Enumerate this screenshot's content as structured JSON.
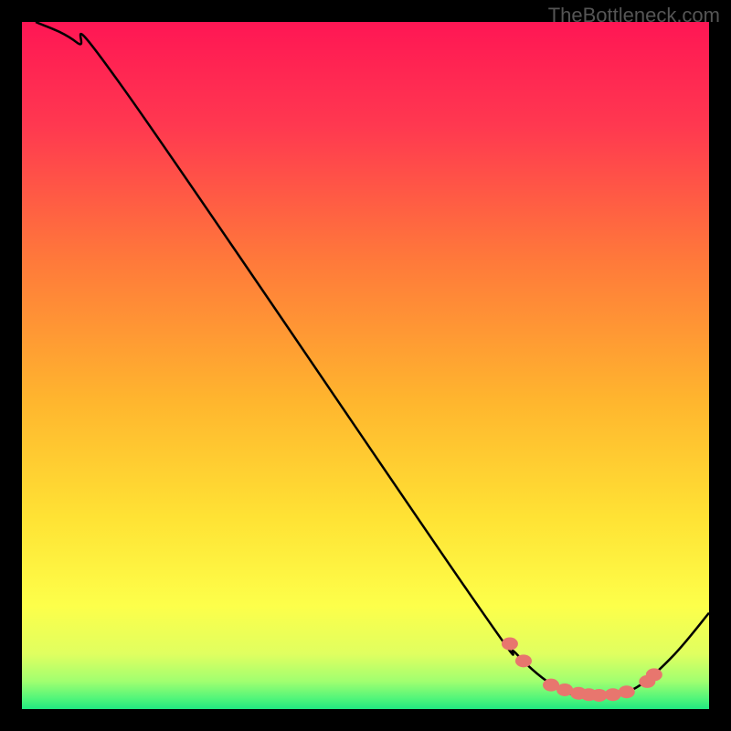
{
  "watermark": "TheBottleneck.com",
  "chart_data": {
    "type": "line",
    "title": "",
    "xlabel": "",
    "ylabel": "",
    "xlim": [
      0,
      100
    ],
    "ylim": [
      0,
      100
    ],
    "curve": {
      "description": "Valley curve descending from top-left, minimum near x=78-88, rising on right",
      "points": [
        {
          "x": 2,
          "y": 100
        },
        {
          "x": 8,
          "y": 97
        },
        {
          "x": 15,
          "y": 90
        },
        {
          "x": 65,
          "y": 17
        },
        {
          "x": 72,
          "y": 8
        },
        {
          "x": 78,
          "y": 3
        },
        {
          "x": 82,
          "y": 2
        },
        {
          "x": 86,
          "y": 2
        },
        {
          "x": 90,
          "y": 3.5
        },
        {
          "x": 95,
          "y": 8
        },
        {
          "x": 100,
          "y": 14
        }
      ]
    },
    "highlighted_points": [
      {
        "x": 71,
        "y": 9.5
      },
      {
        "x": 73,
        "y": 7
      },
      {
        "x": 77,
        "y": 3.5
      },
      {
        "x": 79,
        "y": 2.8
      },
      {
        "x": 81,
        "y": 2.3
      },
      {
        "x": 82.5,
        "y": 2.1
      },
      {
        "x": 84,
        "y": 2
      },
      {
        "x": 86,
        "y": 2.1
      },
      {
        "x": 88,
        "y": 2.5
      },
      {
        "x": 91,
        "y": 4
      },
      {
        "x": 92,
        "y": 5
      }
    ],
    "gradient_stops": [
      {
        "offset": 0,
        "color": "#ff1654"
      },
      {
        "offset": 0.15,
        "color": "#ff3850"
      },
      {
        "offset": 0.35,
        "color": "#ff7a3a"
      },
      {
        "offset": 0.55,
        "color": "#ffb52e"
      },
      {
        "offset": 0.72,
        "color": "#ffe234"
      },
      {
        "offset": 0.85,
        "color": "#fdff4a"
      },
      {
        "offset": 0.92,
        "color": "#e0ff60"
      },
      {
        "offset": 0.96,
        "color": "#a0ff70"
      },
      {
        "offset": 0.985,
        "color": "#50f57a"
      },
      {
        "offset": 1.0,
        "color": "#20e880"
      }
    ]
  }
}
